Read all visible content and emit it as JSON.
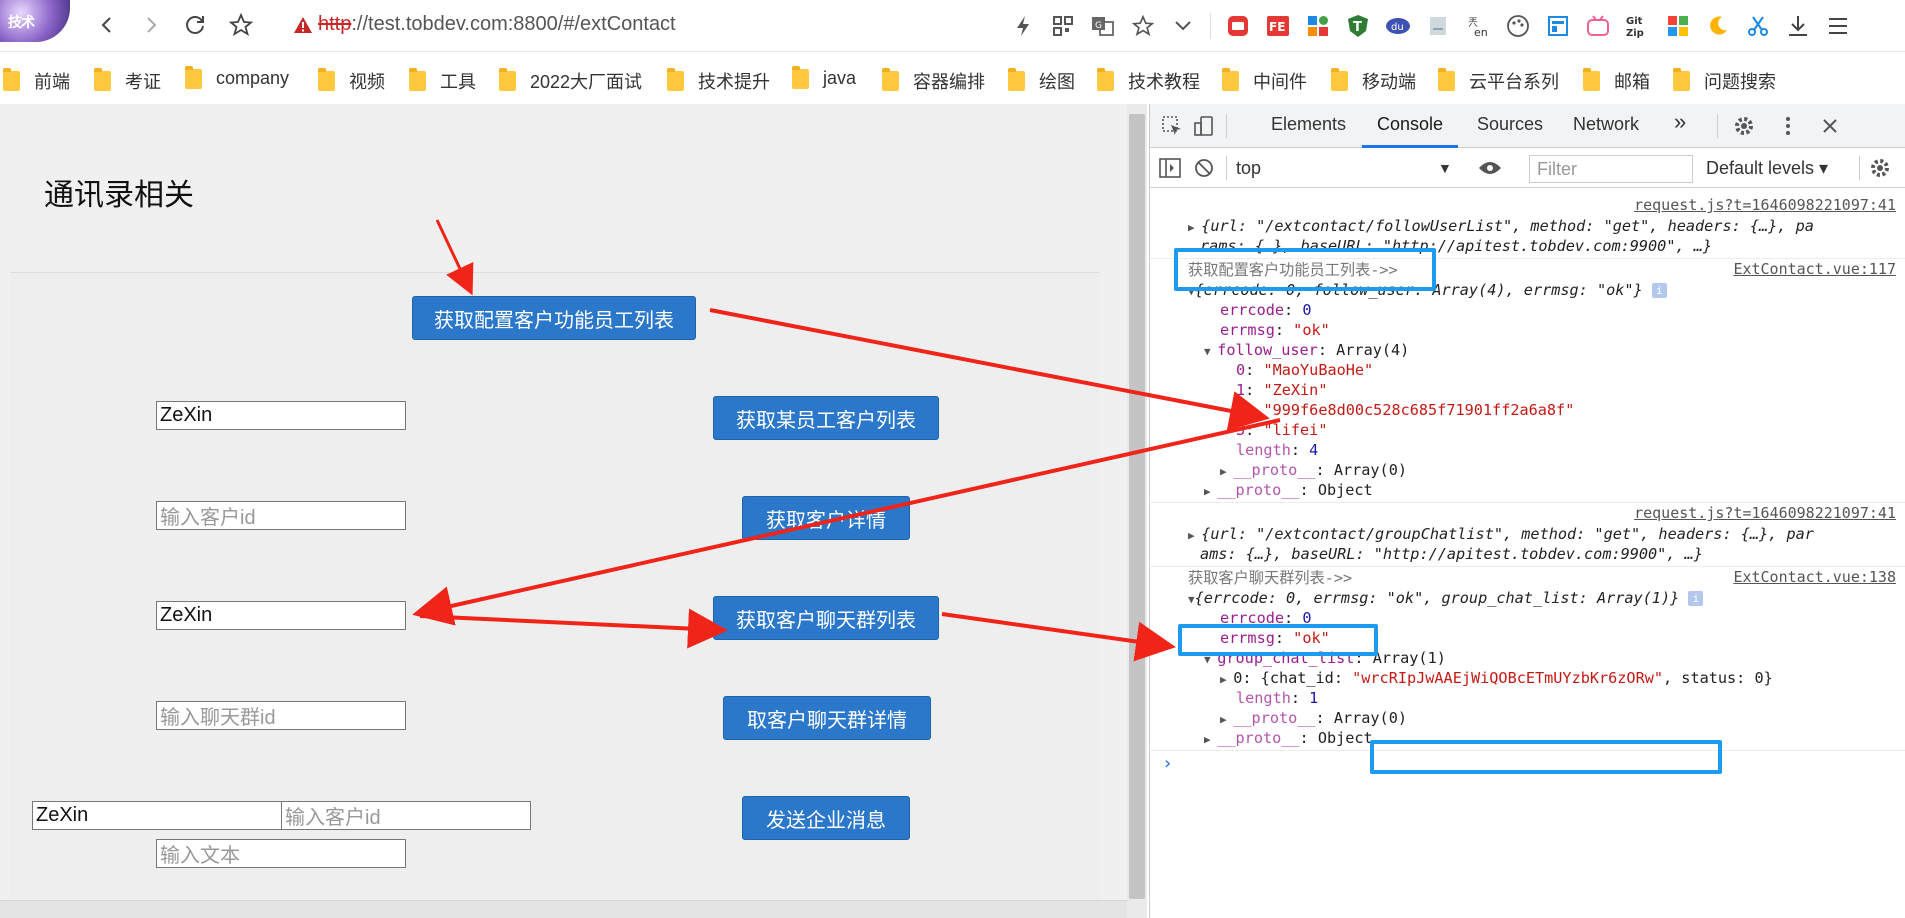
{
  "browser": {
    "avatar_text": "技术",
    "url_protocol": "http",
    "url_rest": "://test.tobdev.com:8800/#/extContact",
    "extensions": [
      "lightning-icon",
      "qr-icon",
      "translate-icon",
      "star-icon",
      "chevron-down-icon",
      "red-app-icon",
      "fe-icon",
      "apps-icon",
      "shield-icon",
      "du-icon",
      "doc-icon",
      "en-icon",
      "palette-icon",
      "calendar-icon",
      "bilibili-icon",
      "gitzip-icon",
      "windows-icon",
      "moon-icon",
      "scissors-icon",
      "download-icon",
      "menu-icon"
    ],
    "ext_labels": {
      "fe": "FE",
      "du": "du",
      "en": "en",
      "gitzip_1": "Git",
      "gitzip_2": "Zip"
    }
  },
  "bookmarks": [
    "前端",
    "考证",
    "company",
    "视频",
    "工具",
    "2022大厂面试",
    "技术提升",
    "java",
    "容器编排",
    "绘图",
    "技术教程",
    "中间件",
    "移动端",
    "云平台系列",
    "邮箱",
    "问题搜索"
  ],
  "app": {
    "title": "通讯录相关",
    "btn_follow_list": "获取配置客户功能员工列表",
    "btn_customer_list": "获取某员工客户列表",
    "btn_customer_detail": "获取客户详情",
    "btn_group_list": "获取客户聊天群列表",
    "btn_group_detail": "取客户聊天群详情",
    "btn_send_msg": "发送企业消息",
    "input_user_1": "ZeXin",
    "input_customer_id_ph": "输入客户id",
    "input_user_2": "ZeXin",
    "input_group_id_ph": "输入聊天群id",
    "input_user_3": "ZeXin",
    "input_customer_id_2_ph": "输入客户id",
    "input_text_ph": "输入文本"
  },
  "devtools": {
    "tabs": [
      "Elements",
      "Console",
      "Sources",
      "Network"
    ],
    "active_tab": "Console",
    "more_tabs": "»",
    "context": "top",
    "filter_placeholder": "Filter",
    "levels": "Default levels ▾",
    "prompt": "›",
    "log": {
      "src1": "request.js?t=1646098221097:41",
      "req1_line1": "{url: \"/extcontact/followUserList\", method: \"get\", headers: {…}, pa",
      "req1_line2": "rams: {…}, baseURL: \"http://apitest.tobdev.com:9900\", …}",
      "label1": "获取配置客户功能员工列表->>",
      "src2": "ExtContact.vue:117",
      "obj1_summary": "{errcode: 0, follow_user: Array(4), errmsg: \"ok\"}",
      "errcode_key": "errcode",
      "errcode_val": "0",
      "errmsg_key": "errmsg",
      "errmsg_val": "\"ok\"",
      "follow_user_key": "follow_user",
      "follow_user_type": "Array(4)",
      "follow_users": [
        "\"MaoYuBaoHe\"",
        "\"ZeXin\"",
        "\"999f6e8d00c528c685f71901ff2a6a8f\"",
        "\"lifei\""
      ],
      "length_key": "length",
      "length_val": "4",
      "proto_key": "__proto__",
      "proto_array": "Array(0)",
      "proto_object": "Object",
      "src3": "request.js?t=1646098221097:41",
      "req2_line1": "{url: \"/extcontact/groupChatlist\", method: \"get\", headers: {…}, par",
      "req2_line2": "ams: {…}, baseURL: \"http://apitest.tobdev.com:9900\", …}",
      "label2": "获取客户聊天群列表->>",
      "src4": "ExtContact.vue:138",
      "obj2_summary": "{errcode: 0, errmsg: \"ok\", group_chat_list: Array(1)}",
      "group_chat_key": "group_chat_list",
      "group_chat_type": "Array(1)",
      "chat_item_prefix": "0: {chat_id: ",
      "chat_id": "\"wrcRIpJwAAEjWiQOBcETmUYzbKr6zORw\"",
      "chat_item_suffix": ", status: 0}",
      "length2_val": "1"
    }
  },
  "colors": {
    "button_blue": "#2b77c9",
    "arrow_red": "#f02418",
    "highlight_blue": "#1e9bf0",
    "accent": "#1a73e8"
  }
}
